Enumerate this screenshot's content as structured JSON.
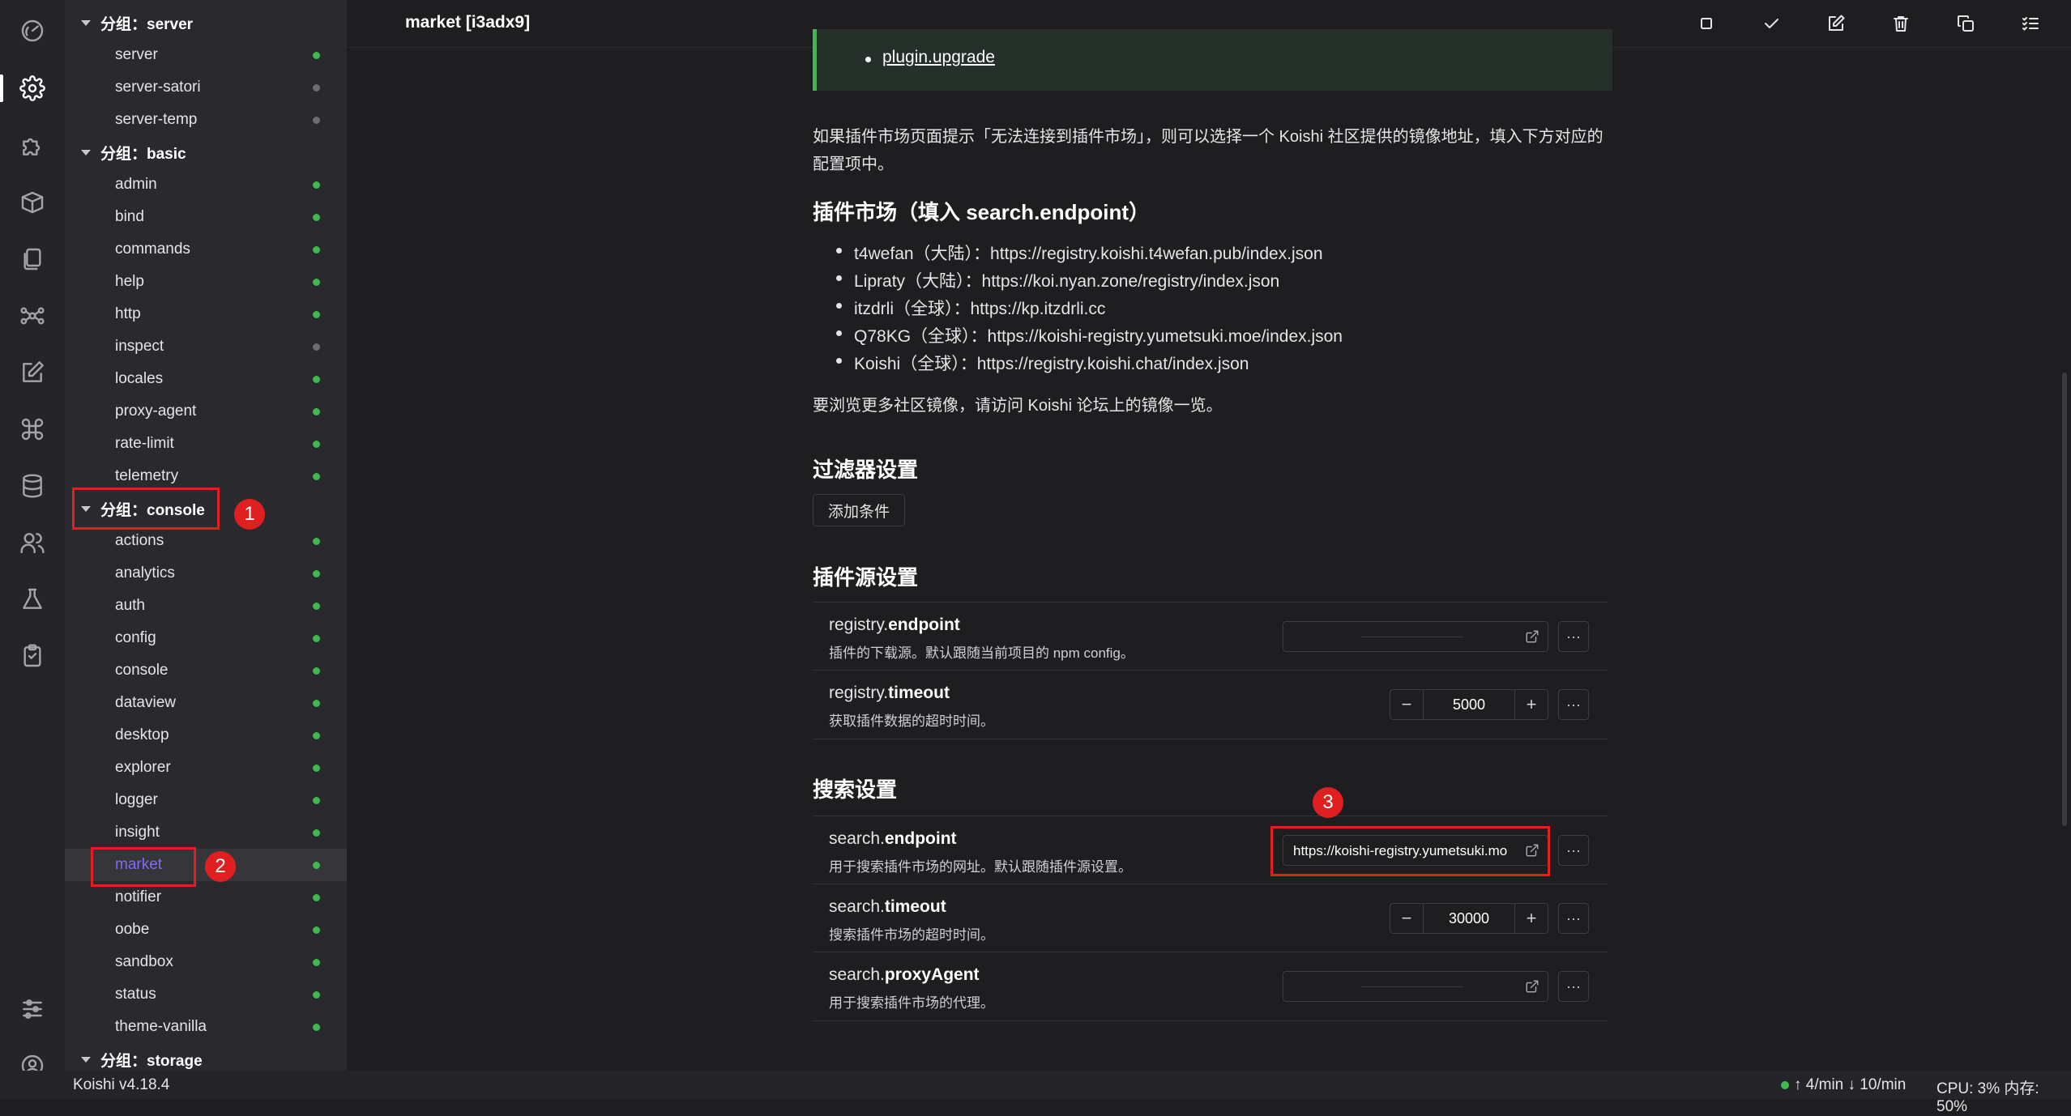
{
  "activity_bar": {
    "icons": [
      "dashboard-icon",
      "settings-icon",
      "plugin-icon",
      "box-icon",
      "files-icon",
      "graph-icon",
      "edit-icon",
      "command-icon",
      "database-icon",
      "users-icon",
      "flask-icon",
      "clipboard-icon",
      "sliders-icon",
      "user-circle-icon"
    ]
  },
  "sidebar": {
    "groups": [
      {
        "label": "分组：server",
        "items": [
          {
            "label": "server",
            "status": "on"
          },
          {
            "label": "server-satori",
            "status": "off"
          },
          {
            "label": "server-temp",
            "status": "off"
          }
        ]
      },
      {
        "label": "分组：basic",
        "items": [
          {
            "label": "admin",
            "status": "on"
          },
          {
            "label": "bind",
            "status": "on"
          },
          {
            "label": "commands",
            "status": "on"
          },
          {
            "label": "help",
            "status": "on"
          },
          {
            "label": "http",
            "status": "on"
          },
          {
            "label": "inspect",
            "status": "off"
          },
          {
            "label": "locales",
            "status": "on"
          },
          {
            "label": "proxy-agent",
            "status": "on"
          },
          {
            "label": "rate-limit",
            "status": "on"
          },
          {
            "label": "telemetry",
            "status": "on"
          }
        ]
      },
      {
        "label": "分组：console",
        "items": [
          {
            "label": "actions",
            "status": "on"
          },
          {
            "label": "analytics",
            "status": "on"
          },
          {
            "label": "auth",
            "status": "on"
          },
          {
            "label": "config",
            "status": "on"
          },
          {
            "label": "console",
            "status": "on"
          },
          {
            "label": "dataview",
            "status": "on"
          },
          {
            "label": "desktop",
            "status": "on"
          },
          {
            "label": "explorer",
            "status": "on"
          },
          {
            "label": "logger",
            "status": "on"
          },
          {
            "label": "insight",
            "status": "on"
          },
          {
            "label": "market",
            "status": "on",
            "selected": true
          },
          {
            "label": "notifier",
            "status": "on"
          },
          {
            "label": "oobe",
            "status": "on"
          },
          {
            "label": "sandbox",
            "status": "on"
          },
          {
            "label": "status",
            "status": "on"
          },
          {
            "label": "theme-vanilla",
            "status": "on"
          }
        ]
      },
      {
        "label": "分组：storage",
        "items": []
      }
    ]
  },
  "header": {
    "title": "market [i3adx9]",
    "toolbar_icons": [
      "stop-icon",
      "check-icon",
      "edit-icon",
      "trash-icon",
      "copy-icon",
      "list-check-icon"
    ]
  },
  "content": {
    "tip_link": "plugin.upgrade",
    "mirror_intro": "如果插件市场页面提示「无法连接到插件市场」，则可以选择一个 Koishi 社区提供的镜像地址，填入下方对应的配置项中。",
    "market_heading": "插件市场（填入 search.endpoint）",
    "mirrors": [
      "t4wefan（大陆）：https://registry.koishi.t4wefan.pub/index.json",
      "Lipraty（大陆）：https://koi.nyan.zone/registry/index.json",
      "itzdrli（全球）：https://kp.itzdrli.cc",
      "Q78KG（全球）：https://koishi-registry.yumetsuki.moe/index.json",
      "Koishi（全球）：https://registry.koishi.chat/index.json"
    ],
    "mirror_more": "要浏览更多社区镜像，请访问 Koishi 论坛上的镜像一览。",
    "filter_heading": "过滤器设置",
    "add_condition": "添加条件",
    "registry_heading": "插件源设置",
    "registry_rows": [
      {
        "prefix": "registry.",
        "key": "endpoint",
        "desc": "插件的下载源。默认跟随当前项目的 npm config。",
        "type": "url",
        "value": ""
      },
      {
        "prefix": "registry.",
        "key": "timeout",
        "desc": "获取插件数据的超时时间。",
        "type": "number",
        "value": "5000"
      }
    ],
    "search_heading": "搜索设置",
    "search_rows": [
      {
        "prefix": "search.",
        "key": "endpoint",
        "desc": "用于搜索插件市场的网址。默认跟随插件源设置。",
        "type": "url",
        "value": "https://koishi-registry.yumetsuki.moe/index.json"
      },
      {
        "prefix": "search.",
        "key": "timeout",
        "desc": "搜索插件市场的超时时间。",
        "type": "number",
        "value": "30000"
      },
      {
        "prefix": "search.",
        "key": "proxyAgent",
        "desc": "用于搜索插件市场的代理。",
        "type": "url",
        "value": ""
      }
    ],
    "more_label": "···",
    "minus_label": "−",
    "plus_label": "+"
  },
  "annotations": [
    "1",
    "2",
    "3"
  ],
  "statusbar": {
    "version": "Koishi v4.18.4",
    "net": "↑ 4/min ↓ 10/min",
    "cpu": "CPU: 3% 内存: 50%"
  },
  "colors": {
    "accent": "#7f6cf7",
    "status_on": "#3fb950",
    "status_off": "#6c6c72",
    "annotation": "#e02020"
  }
}
